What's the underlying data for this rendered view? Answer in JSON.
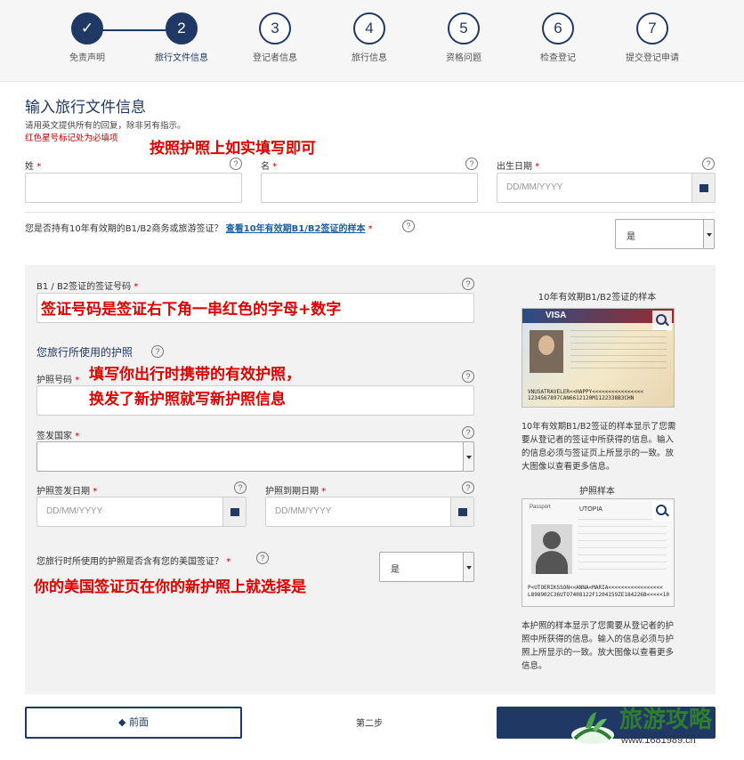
{
  "stepper": {
    "steps": [
      {
        "num": "✓",
        "label": "免责声明"
      },
      {
        "num": "2",
        "label": "旅行文件信息"
      },
      {
        "num": "3",
        "label": "登记者信息"
      },
      {
        "num": "4",
        "label": "旅行信息"
      },
      {
        "num": "5",
        "label": "资格问题"
      },
      {
        "num": "6",
        "label": "检查登记"
      },
      {
        "num": "7",
        "label": "提交登记申请"
      }
    ]
  },
  "header": {
    "title": "输入旅行文件信息",
    "sub1": "请用英文提供所有的回复，除非另有指示。",
    "sub2": "红色星号标记处为必填项"
  },
  "annotations": {
    "a1": "按照护照上如实填写即可",
    "a2": "签证号码是签证右下角一串红色的字母+数字",
    "a3_line1": "填写你出行时携带的有效护照，",
    "a3_line2": "换发了新护照就写新护照信息",
    "a4": "你的美国签证页在你的新护照上就选择是"
  },
  "form": {
    "surname_label": "姓",
    "given_label": "名",
    "dob_label": "出生日期",
    "date_placeholder": "DD/MM/YYYY",
    "visa10_question": "您是否持有10年有效期的B1/B2商务或旅游签证？",
    "visa10_link": "查看10年有效期B1/B2签证的样本",
    "visa10_value": "是",
    "visa_number_label": "B1 / B2签证的签证号码",
    "passport_section": "您旅行所使用的护照",
    "passport_number_label": "护照号码",
    "issuing_country_label": "签发国家",
    "issue_date_label": "护照签发日期",
    "expiry_date_label": "护照到期日期",
    "visa_in_passport_question": "您旅行时所使用的护照是否含有您的美国签证？",
    "visa_in_passport_value": "是",
    "required_mark": "*",
    "help": "?"
  },
  "sidebar": {
    "visa_sample_title": "10年有效期B1/B2签证的样本",
    "visa_sample_text": "10年有效期B1/B2签证的样本显示了您需要从登记者的签证中所获得的信息。输入的信息必须与签证页上所显示的一致。放大图像以查看更多信息。",
    "visa_card_title": "VISA",
    "visa_mrz": "VNUSATRAVELER<<HAPPY<<<<<<<<<<<<<<<< 1234567897CAN6612120M1122338B3CHN",
    "passport_sample_title": "护照样本",
    "passport_sample_text": "本护照的样本显示了您需要从登记者的护照中所获得的信息。输入的信息必须与护照上所显示的一致。放大图像以查看更多信息。",
    "passport_card_title": "Passport",
    "passport_country": "UTOPIA",
    "passport_mrz": "P<UTOERIKSSON<<ANNA<MARIA<<<<<<<<<<<<<<<<< L898902C36UTO7408122F1204159ZE184226B<<<<<10"
  },
  "footer": {
    "prev_label": "◆ 前面",
    "step_label": "第二步"
  },
  "watermark": {
    "text": "旅游攻略",
    "url": "www.1681989.cn"
  }
}
